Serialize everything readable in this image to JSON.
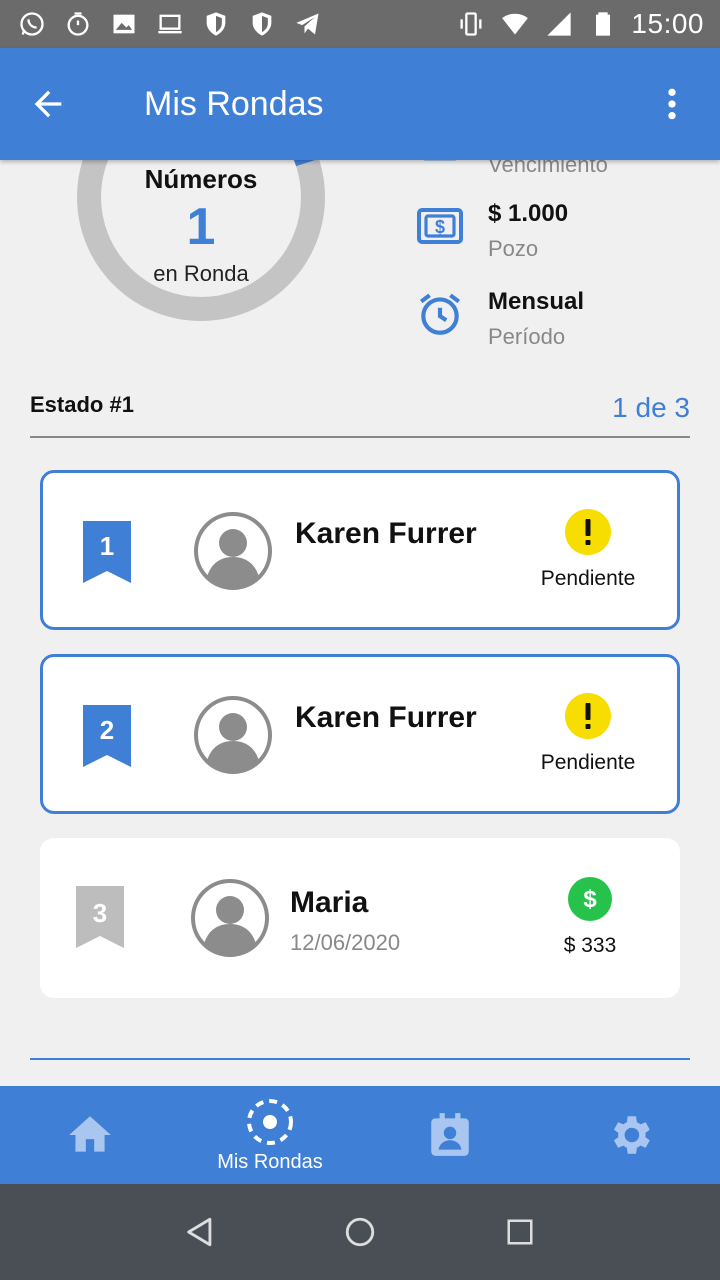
{
  "status_bar": {
    "time": "15:00"
  },
  "app_bar": {
    "title": "Mis Rondas"
  },
  "summary": {
    "donut_title": "Números",
    "donut_number": "1",
    "donut_sub": "en Ronda",
    "donut_progress": 0.2,
    "vencimiento_label": "Vencimiento",
    "pozo_value": "$ 1.000",
    "pozo_label": "Pozo",
    "periodo_value": "Mensual",
    "periodo_label": "Período"
  },
  "estado": {
    "label": "Estado #1",
    "count": "1 de 3"
  },
  "participants": [
    {
      "number": "1",
      "name": "Karen Furrer",
      "status": "Pendiente",
      "active": true
    },
    {
      "number": "2",
      "name": "Karen Furrer",
      "status": "Pendiente",
      "active": true
    },
    {
      "number": "3",
      "name": "Maria",
      "date": "12/06/2020",
      "status": "$ 333",
      "active": false
    }
  ],
  "bottom_nav": {
    "mis_rondas_label": "Mis Rondas"
  },
  "colors": {
    "primary": "#3f7fd6",
    "warning": "#f7dd00",
    "paid": "#27c24c",
    "inactive": "#bdbdbd"
  }
}
